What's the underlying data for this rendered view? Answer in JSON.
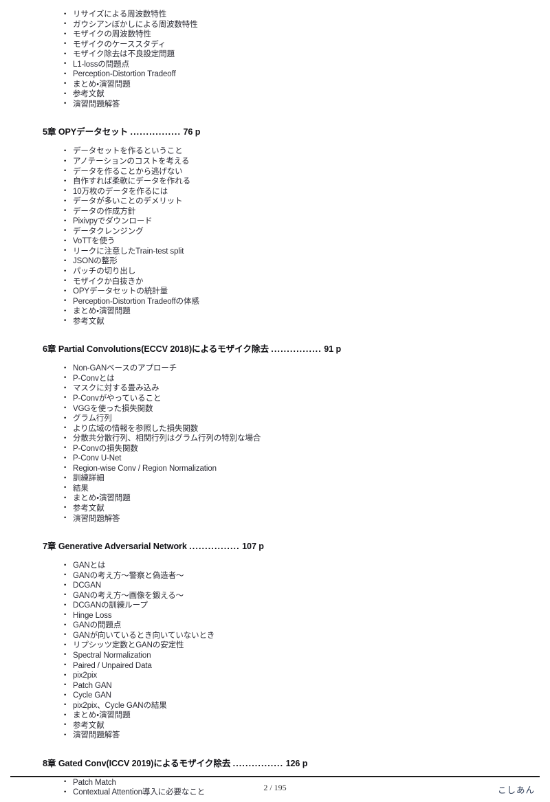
{
  "document": {
    "type": "table-of-contents",
    "page_label": "2 / 195",
    "author": "こしあん"
  },
  "leader": "................",
  "sections": [
    {
      "id": "chapter-4-continued",
      "heading": null,
      "items": [
        "リサイズによる周波数特性",
        "ガウシアンぼかしによる周波数特性",
        "モザイクの周波数特性",
        "モザイクのケーススタディ",
        "モザイク除去は不良設定問題",
        "L1-lossの問題点",
        "Perception-Distortion Tradeoff",
        "まとめ・演習問題",
        "参考文献",
        "演習問題解答"
      ]
    },
    {
      "id": "chapter-5",
      "heading": {
        "number": "5章",
        "title": "OPYデータセット",
        "page": "76 p"
      },
      "items": [
        "データセットを作るということ",
        "アノテーションのコストを考える",
        "データを作ることから逃げない",
        "自作すれば柔軟にデータを作れる",
        "10万枚のデータを作るには",
        "データが多いことのデメリット",
        "データの作成方針",
        "Pixivpyでダウンロード",
        "データクレンジング",
        "VoTTを使う",
        "リークに注意したTrain-test split",
        "JSONの整形",
        "パッチの切り出し",
        "モザイクか白抜きか",
        "OPYデータセットの統計量",
        "Perception-Distortion Tradeoffの体感",
        "まとめ・演習問題",
        "参考文献"
      ]
    },
    {
      "id": "chapter-6",
      "heading": {
        "number": "6章",
        "title": "Partial Convolutions(ECCV 2018)によるモザイク除去",
        "page": "91 p"
      },
      "items": [
        "Non-GANベースのアプローチ",
        "P-Convとは",
        "マスクに対する畳み込み",
        "P-Convがやっていること",
        "VGGを使った損失関数",
        "グラム行列",
        "より広域の情報を参照した損失関数",
        "分散共分散行列、相関行列はグラム行列の特別な場合",
        "P-Convの損失関数",
        "P-Conv U-Net",
        "Region-wise Conv / Region Normalization",
        "訓練詳細",
        "結果",
        "まとめ・演習問題",
        "参考文献",
        "演習問題解答"
      ]
    },
    {
      "id": "chapter-7",
      "heading": {
        "number": "7章",
        "title": "Generative Adversarial Network",
        "page": "107 p"
      },
      "items": [
        "GANとは",
        "GANの考え方〜警察と偽造者〜",
        "DCGAN",
        "GANの考え方〜画像を鍛える〜",
        "DCGANの訓練ループ",
        "Hinge Loss",
        "GANの問題点",
        "GANが向いているとき向いていないとき",
        "リプシッツ定数とGANの安定性",
        "Spectral Normalization",
        "Paired / Unpaired Data",
        "pix2pix",
        "Patch GAN",
        "Cycle GAN",
        "pix2pix、Cycle GANの結果",
        "まとめ・演習問題",
        "参考文献",
        "演習問題解答"
      ]
    },
    {
      "id": "chapter-8",
      "heading": {
        "number": "8章",
        "title": "Gated Conv(ICCV 2019)によるモザイク除去",
        "page": "126 p"
      },
      "items": [
        "Patch Match",
        "Contextual Attention導入に必要なこと"
      ]
    }
  ]
}
